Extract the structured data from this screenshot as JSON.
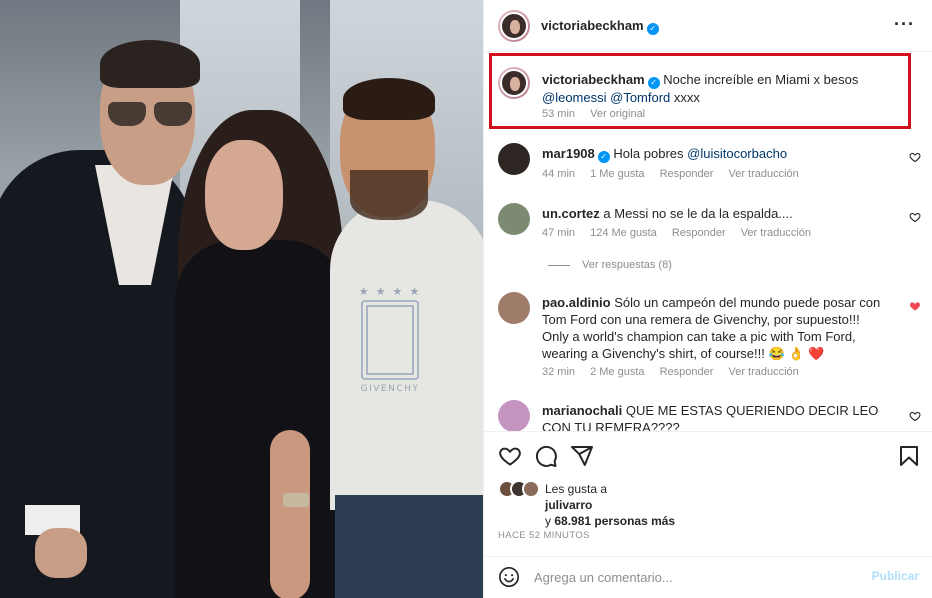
{
  "post": {
    "author": "victoriabeckham",
    "verified_icon": "verified-badge-icon",
    "more_icon": "more-options-icon"
  },
  "caption": {
    "username": "victoriabeckham",
    "text": "Noche increíble en Miami x besos",
    "mentions": [
      "@leomessi",
      "@Tomford"
    ],
    "trailing": "xxxx",
    "time": "53 min",
    "see_original": "Ver original"
  },
  "comments": [
    {
      "username": "mar1908",
      "verified": true,
      "text": "Hola pobres",
      "mention": "@luisitocorbacho",
      "time": "44 min",
      "likes": "1 Me gusta",
      "reply": "Responder",
      "translate": "Ver traducción",
      "liked": false
    },
    {
      "username": "un.cortez",
      "verified": false,
      "text": "a Messi no se le da la espalda....",
      "time": "47 min",
      "likes": "124 Me gusta",
      "reply": "Responder",
      "translate": "Ver traducción",
      "liked": false
    },
    {
      "username": "pao.aldinio",
      "verified": false,
      "text": "Sólo un campeón del mundo puede posar con Tom Ford con una remera de Givenchy, por supuesto!!! Only a world's champion can take a pic with Tom Ford, wearing a Givenchy's shirt, of course!!! 😂 👌 ❤️",
      "time": "32 min",
      "likes": "2 Me gusta",
      "reply": "Responder",
      "translate": "Ver traducción",
      "liked": true
    },
    {
      "username": "marianochali",
      "verified": false,
      "text": "QUE ME ESTAS QUERIENDO DECIR LEO CON TU REMERA????",
      "liked": false
    }
  ],
  "view_replies": "Ver respuestas (8)",
  "likes": {
    "prefix": "Les gusta a",
    "first_user": "julivarro",
    "and": "y",
    "count": "68.981",
    "suffix": "personas más"
  },
  "timestamp": "HACE 52 MINUTOS",
  "add_comment": {
    "placeholder": "Agrega un comentario...",
    "publish": "Publicar"
  },
  "photo": {
    "shirt_brand": "GIVENCHY",
    "shirt_stars": "★ ★ ★ ★"
  },
  "colors": {
    "highlight_border": "#d1101e",
    "like_red": "#ed4956",
    "link_blue": "#00376b",
    "verified_blue": "#0095f6"
  }
}
